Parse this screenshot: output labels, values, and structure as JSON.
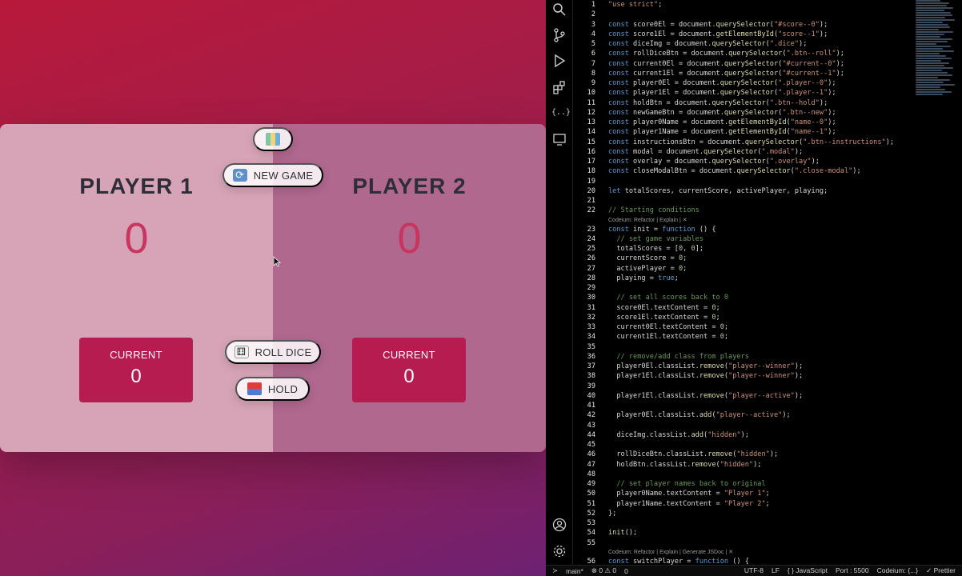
{
  "game": {
    "instructions_icon": "map-icon",
    "new_game_label": "NEW GAME",
    "roll_dice_label": "ROLL DICE",
    "hold_label": "HOLD",
    "players": [
      {
        "name": "PLAYER 1",
        "score": "0",
        "current_label": "CURRENT",
        "current_score": "0"
      },
      {
        "name": "PLAYER 2",
        "score": "0",
        "current_label": "CURRENT",
        "current_score": "0"
      }
    ],
    "colors": {
      "accent": "#c7365f",
      "current_box": "#b61c4f",
      "player1_bg": "#d7a4b7",
      "player2_bg": "#b0688f"
    }
  },
  "editor": {
    "lines": [
      {
        "n": "1",
        "t": "\"use strict\";"
      },
      {
        "n": "2",
        "t": ""
      },
      {
        "n": "3",
        "t": "const score0El = document.querySelector(\"#score--0\");"
      },
      {
        "n": "4",
        "t": "const score1El = document.getElementById(\"score--1\");"
      },
      {
        "n": "5",
        "t": "const diceImg = document.querySelector(\".dice\");"
      },
      {
        "n": "6",
        "t": "const rollDiceBtn = document.querySelector(\".btn--roll\");"
      },
      {
        "n": "7",
        "t": "const current0El = document.querySelector(\"#current--0\");"
      },
      {
        "n": "8",
        "t": "const current1El = document.querySelector(\"#current--1\");"
      },
      {
        "n": "9",
        "t": "const player0El = document.querySelector(\".player--0\");"
      },
      {
        "n": "10",
        "t": "const player1El = document.querySelector(\".player--1\");"
      },
      {
        "n": "11",
        "t": "const holdBtn = document.querySelector(\".btn--hold\");"
      },
      {
        "n": "12",
        "t": "const newGameBtn = document.querySelector(\".btn--new\");"
      },
      {
        "n": "13",
        "t": "const player0Name = document.getElementById(\"name--0\");"
      },
      {
        "n": "14",
        "t": "const player1Name = document.getElementById(\"name--1\");"
      },
      {
        "n": "15",
        "t": "const instructionsBtn = document.querySelector(\".btn--instructions\");"
      },
      {
        "n": "16",
        "t": "const modal = document.querySelector(\".modal\");"
      },
      {
        "n": "17",
        "t": "const overlay = document.querySelector(\".overlay\");"
      },
      {
        "n": "18",
        "t": "const closeModalBtn = document.querySelector(\".close-modal\");"
      },
      {
        "n": "19",
        "t": ""
      },
      {
        "n": "20",
        "t": "let totalScores, currentScore, activePlayer, playing;"
      },
      {
        "n": "21",
        "t": ""
      },
      {
        "n": "22",
        "t": "// Starting conditions"
      },
      {
        "lens": "Codeium: Refactor | Explain | ✕"
      },
      {
        "n": "23",
        "t": "const init = function () {"
      },
      {
        "n": "24",
        "t": "  // set game variables"
      },
      {
        "n": "25",
        "t": "  totalScores = [0, 0];"
      },
      {
        "n": "26",
        "t": "  currentScore = 0;"
      },
      {
        "n": "27",
        "t": "  activePlayer = 0;"
      },
      {
        "n": "28",
        "t": "  playing = true;"
      },
      {
        "n": "29",
        "t": ""
      },
      {
        "n": "30",
        "t": "  // set all scores back to 0"
      },
      {
        "n": "31",
        "t": "  score0El.textContent = 0;"
      },
      {
        "n": "32",
        "t": "  score1El.textContent = 0;"
      },
      {
        "n": "33",
        "t": "  current0El.textContent = 0;"
      },
      {
        "n": "34",
        "t": "  current1El.textContent = 0;"
      },
      {
        "n": "35",
        "t": ""
      },
      {
        "n": "36",
        "t": "  // remove/add class from players"
      },
      {
        "n": "37",
        "t": "  player0El.classList.remove(\"player--winner\");"
      },
      {
        "n": "38",
        "t": "  player1El.classList.remove(\"player--winner\");"
      },
      {
        "n": "39",
        "t": ""
      },
      {
        "n": "40",
        "t": "  player1El.classList.remove(\"player--active\");"
      },
      {
        "n": "41",
        "t": ""
      },
      {
        "n": "42",
        "t": "  player0El.classList.add(\"player--active\");"
      },
      {
        "n": "43",
        "t": ""
      },
      {
        "n": "44",
        "t": "  diceImg.classList.add(\"hidden\");"
      },
      {
        "n": "45",
        "t": ""
      },
      {
        "n": "46",
        "t": "  rollDiceBtn.classList.remove(\"hidden\");"
      },
      {
        "n": "47",
        "t": "  holdBtn.classList.remove(\"hidden\");"
      },
      {
        "n": "48",
        "t": ""
      },
      {
        "n": "49",
        "t": "  // set player names back to original"
      },
      {
        "n": "50",
        "t": "  player0Name.textContent = \"Player 1\";"
      },
      {
        "n": "51",
        "t": "  player1Name.textContent = \"Player 2\";"
      },
      {
        "n": "52",
        "t": "};"
      },
      {
        "n": "53",
        "t": ""
      },
      {
        "n": "54",
        "t": "init();"
      },
      {
        "n": "55",
        "t": ""
      },
      {
        "lens": "Codeium: Refactor | Explain | Generate JSDoc | ✕"
      },
      {
        "n": "56",
        "t": "const switchPlayer = function () {"
      }
    ],
    "status": {
      "branch": "main*",
      "errors": "⊗ 0 ⚠ 0",
      "ports": "0",
      "encoding": "UTF-8",
      "eol": "LF",
      "language": "{ } JavaScript",
      "port": "Port : 5500",
      "codeium": "Codeium: {...}",
      "prettier": "✓ Prettier"
    }
  }
}
